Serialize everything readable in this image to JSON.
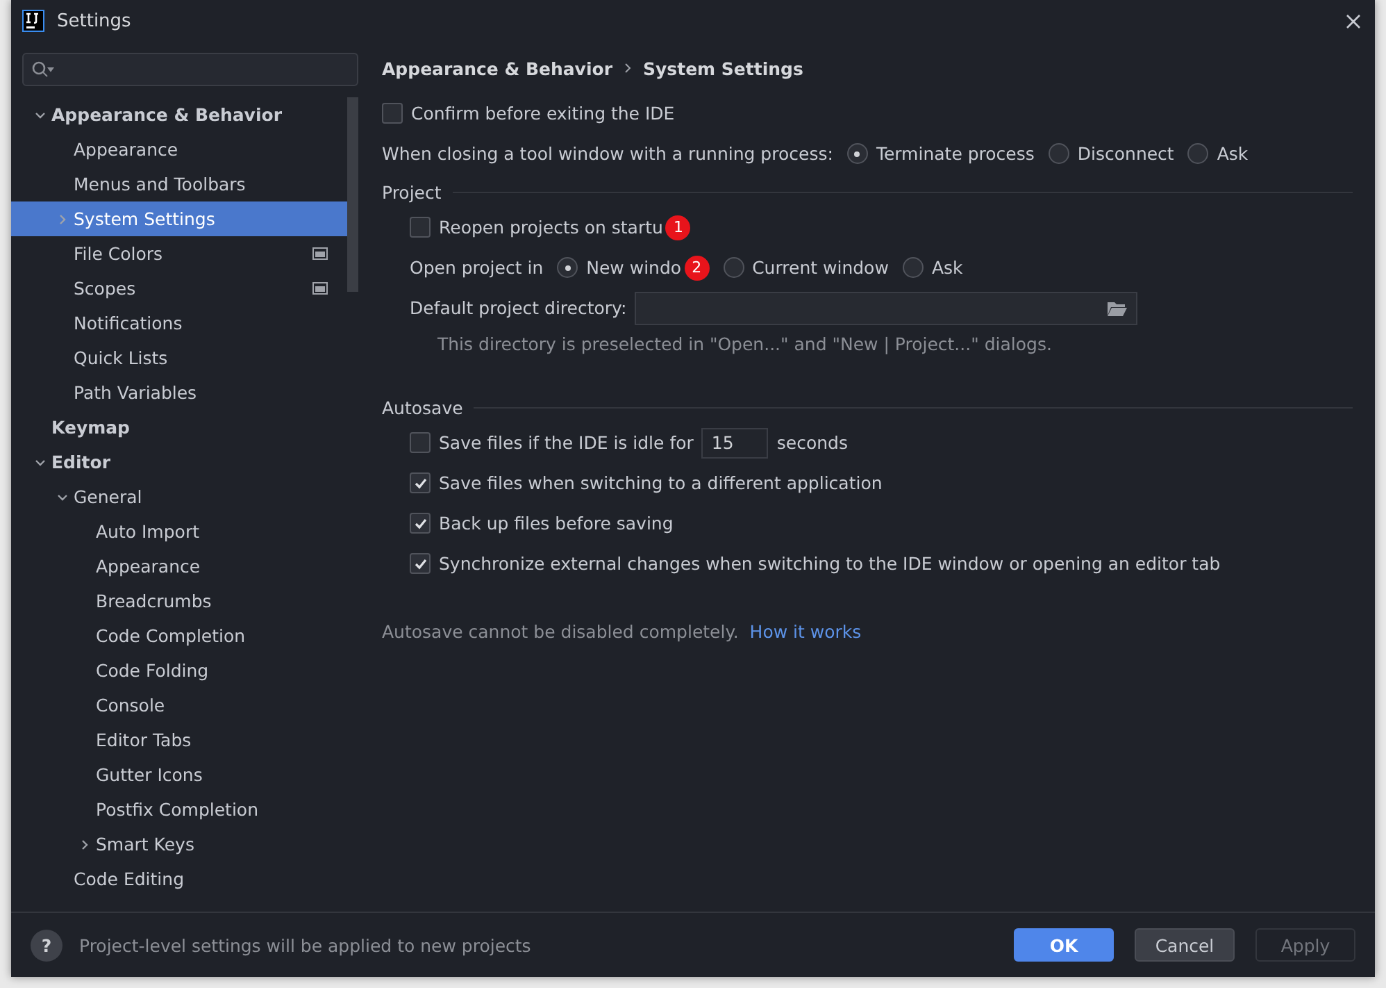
{
  "window": {
    "title": "Settings"
  },
  "sidebar": {
    "tree": [
      {
        "label": "Appearance & Behavior",
        "expanded": true,
        "selected": false,
        "children": [
          {
            "label": "Appearance",
            "selected": false
          },
          {
            "label": "Menus and Toolbars",
            "selected": false
          },
          {
            "label": "System Settings",
            "expanded": false,
            "selected": true
          },
          {
            "label": "File Colors",
            "selected": false,
            "project_level": true
          },
          {
            "label": "Scopes",
            "selected": false,
            "project_level": true
          },
          {
            "label": "Notifications",
            "selected": false
          },
          {
            "label": "Quick Lists",
            "selected": false
          },
          {
            "label": "Path Variables",
            "selected": false
          }
        ]
      },
      {
        "label": "Keymap",
        "selected": false
      },
      {
        "label": "Editor",
        "expanded": true,
        "selected": false,
        "children": [
          {
            "label": "General",
            "expanded": true,
            "selected": false,
            "children": [
              {
                "label": "Auto Import",
                "selected": false
              },
              {
                "label": "Appearance",
                "selected": false
              },
              {
                "label": "Breadcrumbs",
                "selected": false
              },
              {
                "label": "Code Completion",
                "selected": false
              },
              {
                "label": "Code Folding",
                "selected": false
              },
              {
                "label": "Console",
                "selected": false
              },
              {
                "label": "Editor Tabs",
                "selected": false
              },
              {
                "label": "Gutter Icons",
                "selected": false
              },
              {
                "label": "Postfix Completion",
                "selected": false
              },
              {
                "label": "Smart Keys",
                "expanded": false,
                "selected": false
              }
            ]
          },
          {
            "label": "Code Editing",
            "selected": false
          }
        ]
      }
    ]
  },
  "breadcrumb": [
    "Appearance & Behavior",
    "System Settings"
  ],
  "confirm_exit": {
    "label": "Confirm before exiting the IDE",
    "checked": false
  },
  "closing_process": {
    "label": "When closing a tool window with a running process:",
    "options": [
      {
        "label": "Terminate process",
        "selected": true
      },
      {
        "label": "Disconnect",
        "selected": false
      },
      {
        "label": "Ask",
        "selected": false
      }
    ]
  },
  "project": {
    "title": "Project",
    "reopen": {
      "label": "Reopen projects on startu",
      "checked": false,
      "badge": "1"
    },
    "open_in": {
      "label": "Open project in",
      "options": [
        {
          "label": "New windo",
          "selected": true,
          "badge": "2"
        },
        {
          "label": "Current window",
          "selected": false
        },
        {
          "label": "Ask",
          "selected": false
        }
      ]
    },
    "directory": {
      "label": "Default project directory:",
      "hint": "This directory is preselected in \"Open...\" and \"New | Project...\" dialogs."
    }
  },
  "autosave": {
    "title": "Autosave",
    "items": [
      {
        "kind": "idle",
        "label": "Save files if the IDE is idle for",
        "value": "15",
        "suffix": "seconds",
        "checked": false
      },
      {
        "kind": "plain",
        "label": "Save files when switching to a different application",
        "checked": true
      },
      {
        "kind": "plain",
        "label": "Back up files before saving",
        "checked": true
      },
      {
        "kind": "plain",
        "label": "Synchronize external changes when switching to the IDE window or opening an editor tab",
        "checked": true
      }
    ],
    "note": "Autosave cannot be disabled completely.",
    "link": "How it works"
  },
  "footer": {
    "help": "?",
    "message": "Project-level settings will be applied to new projects",
    "buttons": [
      {
        "label": "OK",
        "kind": "primary"
      },
      {
        "label": "Cancel",
        "kind": "normal"
      },
      {
        "label": "Apply",
        "kind": "disabled"
      }
    ]
  }
}
